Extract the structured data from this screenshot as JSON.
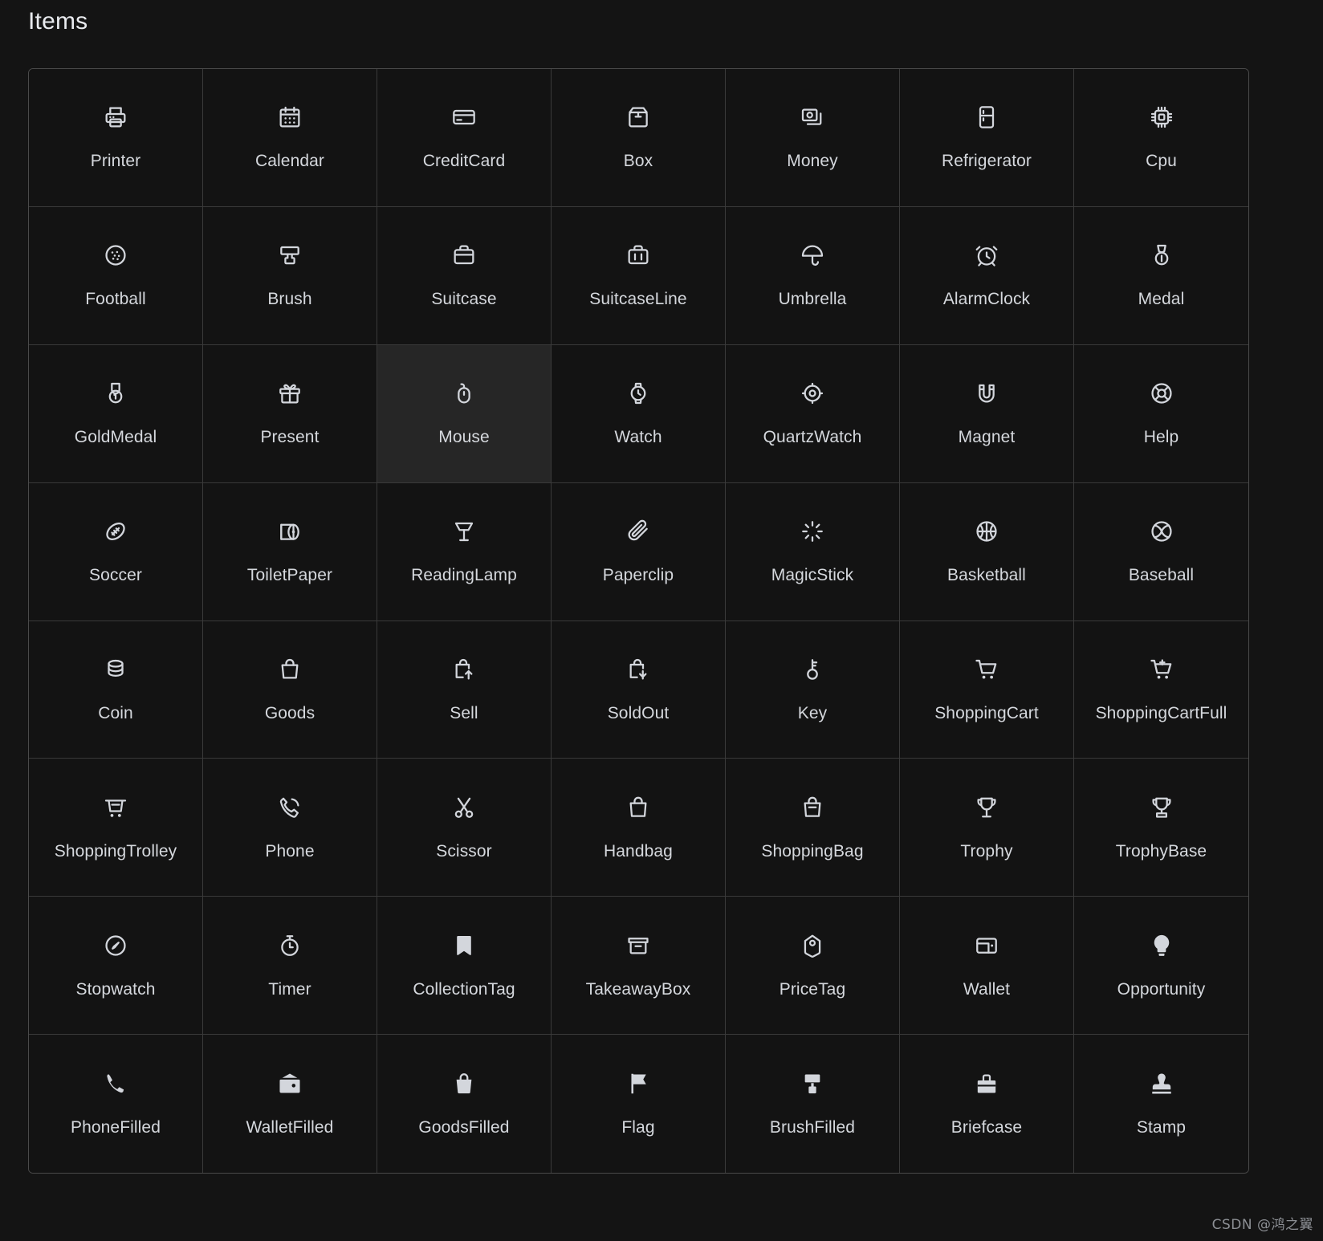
{
  "header": {
    "title": "Items"
  },
  "watermark": {
    "text": "CSDN @鸿之翼"
  },
  "grid": {
    "columns": 7,
    "rows": 8,
    "hovered_item": "Mouse",
    "items": [
      {
        "label": "Printer",
        "icon": "printer-icon",
        "style": "outline"
      },
      {
        "label": "Calendar",
        "icon": "calendar-icon",
        "style": "outline"
      },
      {
        "label": "CreditCard",
        "icon": "credit-card-icon",
        "style": "outline"
      },
      {
        "label": "Box",
        "icon": "box-icon",
        "style": "outline"
      },
      {
        "label": "Money",
        "icon": "money-icon",
        "style": "outline"
      },
      {
        "label": "Refrigerator",
        "icon": "refrigerator-icon",
        "style": "outline"
      },
      {
        "label": "Cpu",
        "icon": "cpu-icon",
        "style": "outline"
      },
      {
        "label": "Football",
        "icon": "football-icon",
        "style": "outline"
      },
      {
        "label": "Brush",
        "icon": "brush-icon",
        "style": "outline"
      },
      {
        "label": "Suitcase",
        "icon": "suitcase-icon",
        "style": "outline"
      },
      {
        "label": "SuitcaseLine",
        "icon": "suitcase-line-icon",
        "style": "outline"
      },
      {
        "label": "Umbrella",
        "icon": "umbrella-icon",
        "style": "outline"
      },
      {
        "label": "AlarmClock",
        "icon": "alarm-clock-icon",
        "style": "outline"
      },
      {
        "label": "Medal",
        "icon": "medal-icon",
        "style": "outline"
      },
      {
        "label": "GoldMedal",
        "icon": "gold-medal-icon",
        "style": "outline"
      },
      {
        "label": "Present",
        "icon": "present-icon",
        "style": "outline"
      },
      {
        "label": "Mouse",
        "icon": "mouse-icon",
        "style": "outline"
      },
      {
        "label": "Watch",
        "icon": "watch-icon",
        "style": "outline"
      },
      {
        "label": "QuartzWatch",
        "icon": "quartz-watch-icon",
        "style": "outline"
      },
      {
        "label": "Magnet",
        "icon": "magnet-icon",
        "style": "outline"
      },
      {
        "label": "Help",
        "icon": "help-icon",
        "style": "outline"
      },
      {
        "label": "Soccer",
        "icon": "soccer-icon",
        "style": "outline"
      },
      {
        "label": "ToiletPaper",
        "icon": "toilet-paper-icon",
        "style": "outline"
      },
      {
        "label": "ReadingLamp",
        "icon": "reading-lamp-icon",
        "style": "outline"
      },
      {
        "label": "Paperclip",
        "icon": "paperclip-icon",
        "style": "outline"
      },
      {
        "label": "MagicStick",
        "icon": "magic-stick-icon",
        "style": "outline"
      },
      {
        "label": "Basketball",
        "icon": "basketball-icon",
        "style": "outline"
      },
      {
        "label": "Baseball",
        "icon": "baseball-icon",
        "style": "outline"
      },
      {
        "label": "Coin",
        "icon": "coin-icon",
        "style": "outline"
      },
      {
        "label": "Goods",
        "icon": "goods-icon",
        "style": "outline"
      },
      {
        "label": "Sell",
        "icon": "sell-icon",
        "style": "outline"
      },
      {
        "label": "SoldOut",
        "icon": "sold-out-icon",
        "style": "outline"
      },
      {
        "label": "Key",
        "icon": "key-icon",
        "style": "outline"
      },
      {
        "label": "ShoppingCart",
        "icon": "shopping-cart-icon",
        "style": "outline"
      },
      {
        "label": "ShoppingCartFull",
        "icon": "shopping-cart-full-icon",
        "style": "outline"
      },
      {
        "label": "ShoppingTrolley",
        "icon": "shopping-trolley-icon",
        "style": "outline"
      },
      {
        "label": "Phone",
        "icon": "phone-icon",
        "style": "outline"
      },
      {
        "label": "Scissor",
        "icon": "scissor-icon",
        "style": "outline"
      },
      {
        "label": "Handbag",
        "icon": "handbag-icon",
        "style": "outline"
      },
      {
        "label": "ShoppingBag",
        "icon": "shopping-bag-icon",
        "style": "outline"
      },
      {
        "label": "Trophy",
        "icon": "trophy-icon",
        "style": "outline"
      },
      {
        "label": "TrophyBase",
        "icon": "trophy-base-icon",
        "style": "outline"
      },
      {
        "label": "Stopwatch",
        "icon": "stopwatch-icon",
        "style": "outline"
      },
      {
        "label": "Timer",
        "icon": "timer-icon",
        "style": "outline"
      },
      {
        "label": "CollectionTag",
        "icon": "collection-tag-icon",
        "style": "filled"
      },
      {
        "label": "TakeawayBox",
        "icon": "takeaway-box-icon",
        "style": "outline"
      },
      {
        "label": "PriceTag",
        "icon": "price-tag-icon",
        "style": "outline"
      },
      {
        "label": "Wallet",
        "icon": "wallet-icon",
        "style": "outline"
      },
      {
        "label": "Opportunity",
        "icon": "opportunity-icon",
        "style": "filled"
      },
      {
        "label": "PhoneFilled",
        "icon": "phone-filled-icon",
        "style": "filled"
      },
      {
        "label": "WalletFilled",
        "icon": "wallet-filled-icon",
        "style": "filled"
      },
      {
        "label": "GoodsFilled",
        "icon": "goods-filled-icon",
        "style": "filled"
      },
      {
        "label": "Flag",
        "icon": "flag-icon",
        "style": "filled"
      },
      {
        "label": "BrushFilled",
        "icon": "brush-filled-icon",
        "style": "filled"
      },
      {
        "label": "Briefcase",
        "icon": "briefcase-icon",
        "style": "filled"
      },
      {
        "label": "Stamp",
        "icon": "stamp-icon",
        "style": "filled"
      }
    ]
  },
  "colors": {
    "background": "#141414",
    "cell_background": "#131313",
    "cell_hover": "#262626",
    "border": "#3a3a3a",
    "outer_border": "#4a4a4a",
    "text": "#d5d8dd",
    "title": "#e9ebef",
    "watermark": "#8c8f94"
  }
}
